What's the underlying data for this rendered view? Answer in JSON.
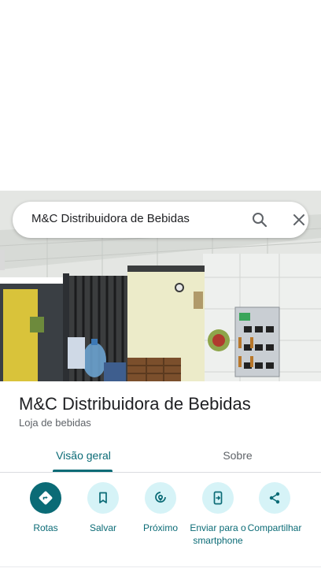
{
  "search": {
    "query": "M&C Distribuidora de Bebidas"
  },
  "place": {
    "name": "M&C Distribuidora de Bebidas",
    "category": "Loja de bebidas"
  },
  "tabs": [
    {
      "label": "Visão geral",
      "active": true
    },
    {
      "label": "Sobre",
      "active": false
    }
  ],
  "actions": [
    {
      "label": "Rotas",
      "icon": "directions-icon"
    },
    {
      "label": "Salvar",
      "icon": "bookmark-icon"
    },
    {
      "label": "Próximo",
      "icon": "nearby-icon"
    },
    {
      "label": "Enviar para o smartphone",
      "icon": "send-to-phone-icon"
    },
    {
      "label": "Compartilhar",
      "icon": "share-icon"
    }
  ],
  "colors": {
    "accent": "#0b6b76",
    "accent_light": "#d6f3f7"
  }
}
